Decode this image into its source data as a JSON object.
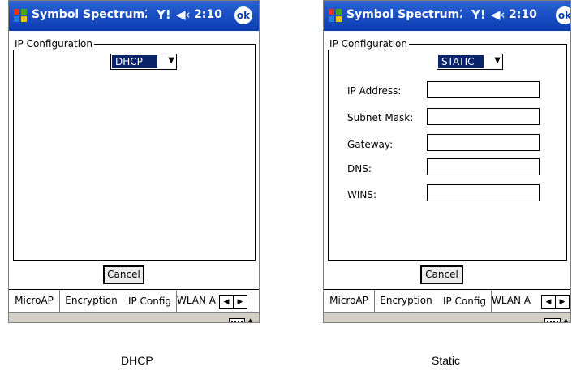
{
  "screens": [
    {
      "id": "dhcp",
      "app_title": "Symbol Spectrum2",
      "time": "2:10",
      "ok_label": "ok",
      "group_label": "IP Configuration",
      "mode_value": "DHCP",
      "cancel_label": "Cancel",
      "tabs": [
        "MicroAP",
        "Encryption",
        "IP Config",
        "WLAN A"
      ],
      "active_tab": "IP Config",
      "caption": "DHCP"
    },
    {
      "id": "static",
      "app_title": "Symbol Spectrum2",
      "time": "2:10",
      "ok_label": "ok",
      "group_label": "IP Configuration",
      "mode_value": "STATIC",
      "fields": [
        {
          "label": "IP Address:",
          "value": ""
        },
        {
          "label": "Subnet Mask:",
          "value": ""
        },
        {
          "label": "Gateway:",
          "value": ""
        },
        {
          "label": "DNS:",
          "value": ""
        },
        {
          "label": "WINS:",
          "value": ""
        }
      ],
      "cancel_label": "Cancel",
      "tabs": [
        "MicroAP",
        "Encryption",
        "IP Config",
        "WLAN A"
      ],
      "active_tab": "IP Config",
      "caption": "Static"
    }
  ],
  "icons": [
    "windows-start-icon",
    "signal-icon",
    "volume-icon",
    "ok-icon",
    "chevron-down-icon",
    "tab-scroll-left-icon",
    "tab-scroll-right-icon",
    "keyboard-icon",
    "sip-arrow-up-icon"
  ],
  "colors": {
    "titlebar": "#0a3cb0",
    "selection": "#0a246a",
    "menubar": "#d4d0c8"
  }
}
